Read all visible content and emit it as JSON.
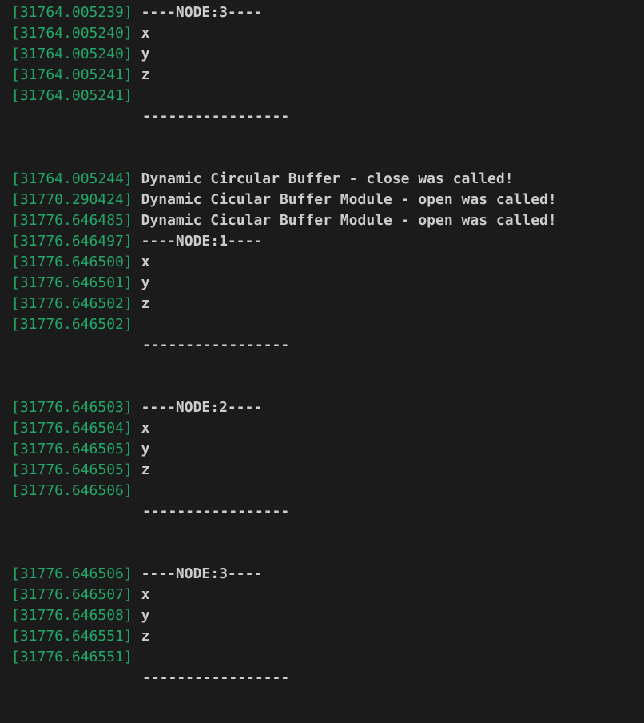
{
  "colors": {
    "background": "#1b1b1b",
    "timestamp": "#23a868",
    "text": "#cccccc"
  },
  "terminal": {
    "lines": [
      {
        "ts": "[31764.005239]",
        "msg": "----NODE:3----"
      },
      {
        "ts": "[31764.005240]",
        "msg": "x"
      },
      {
        "ts": "[31764.005240]",
        "msg": "y"
      },
      {
        "ts": "[31764.005241]",
        "msg": "z"
      },
      {
        "ts": "[31764.005241]",
        "msg": ""
      },
      {
        "sep": "-----------------"
      },
      {
        "ts": "[31764.005244]",
        "msg": "Dynamic Circular Buffer - close was called!"
      },
      {
        "ts": "[31770.290424]",
        "msg": "Dynamic Cicular Buffer Module - open was called!"
      },
      {
        "ts": "[31776.646485]",
        "msg": "Dynamic Cicular Buffer Module - open was called!"
      },
      {
        "ts": "[31776.646497]",
        "msg": "----NODE:1----"
      },
      {
        "ts": "[31776.646500]",
        "msg": "x"
      },
      {
        "ts": "[31776.646501]",
        "msg": "y"
      },
      {
        "ts": "[31776.646502]",
        "msg": "z"
      },
      {
        "ts": "[31776.646502]",
        "msg": ""
      },
      {
        "sep": "-----------------"
      },
      {
        "ts": "[31776.646503]",
        "msg": "----NODE:2----"
      },
      {
        "ts": "[31776.646504]",
        "msg": "x"
      },
      {
        "ts": "[31776.646505]",
        "msg": "y"
      },
      {
        "ts": "[31776.646505]",
        "msg": "z"
      },
      {
        "ts": "[31776.646506]",
        "msg": ""
      },
      {
        "sep": "-----------------"
      },
      {
        "ts": "[31776.646506]",
        "msg": "----NODE:3----"
      },
      {
        "ts": "[31776.646507]",
        "msg": "x"
      },
      {
        "ts": "[31776.646508]",
        "msg": "y"
      },
      {
        "ts": "[31776.646551]",
        "msg": "z"
      },
      {
        "ts": "[31776.646551]",
        "msg": ""
      },
      {
        "sep": "-----------------"
      }
    ]
  }
}
